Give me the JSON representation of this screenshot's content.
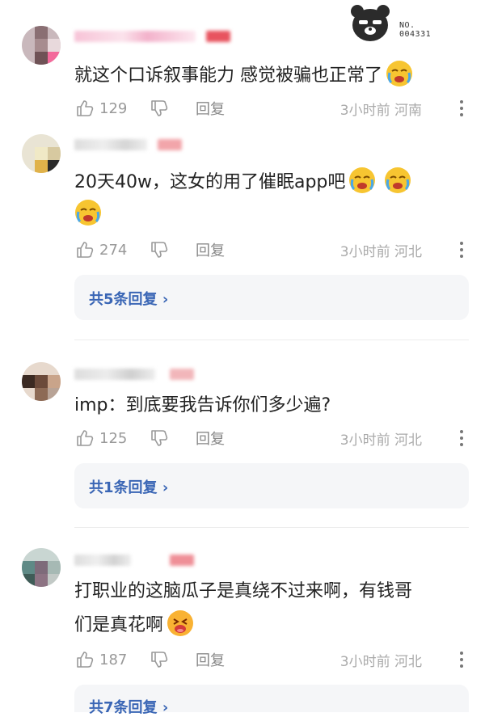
{
  "badge": {
    "icon": "bear-mascot-icon",
    "line1": "NO.",
    "line2": "004331"
  },
  "comments": [
    {
      "text": "就这个口诉叙事能力 感觉被骗也正常了",
      "likes": "129",
      "reply_label": "回复",
      "meta": "3小时前 河南"
    },
    {
      "text": "20天40w，这女的用了催眠app吧",
      "likes": "274",
      "reply_label": "回复",
      "meta": "3小时前 河北",
      "replies_label": "共5条回复"
    },
    {
      "text": "imp：到底要我告诉你们多少遍?",
      "likes": "125",
      "reply_label": "回复",
      "meta": "3小时前 河北",
      "replies_label": "共1条回复"
    },
    {
      "text_line1": "打职业的这脑瓜子是真绕不过来啊，有钱哥",
      "text_line2": "们是真花啊",
      "likes": "187",
      "reply_label": "回复",
      "meta": "3小时前 河北",
      "replies_label": "共7条回复"
    }
  ],
  "colors": {
    "link": "#3a66b5",
    "meta": "#aaaaaa",
    "reply_bg": "#f5f6f8"
  }
}
